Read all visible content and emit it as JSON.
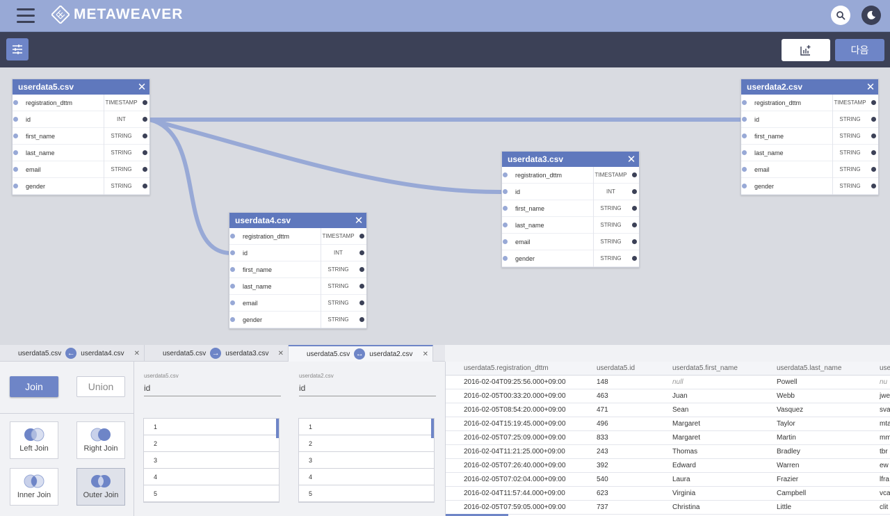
{
  "app": {
    "name": "METAWEAVER"
  },
  "toolbar": {
    "next_label": "다음"
  },
  "colors": {
    "accent": "#6e85c7",
    "header": "#98a9d6",
    "dark": "#3c4157",
    "link": "#98a9d6"
  },
  "tables": [
    {
      "name": "userdata5.csv",
      "columns": [
        {
          "name": "registration_dttm",
          "type": "TIMESTAMP"
        },
        {
          "name": "id",
          "type": "INT"
        },
        {
          "name": "first_name",
          "type": "STRING"
        },
        {
          "name": "last_name",
          "type": "STRING"
        },
        {
          "name": "email",
          "type": "STRING"
        },
        {
          "name": "gender",
          "type": "STRING"
        }
      ]
    },
    {
      "name": "userdata2.csv",
      "columns": [
        {
          "name": "registration_dttm",
          "type": "TIMESTAMP"
        },
        {
          "name": "id",
          "type": "STRING"
        },
        {
          "name": "first_name",
          "type": "STRING"
        },
        {
          "name": "last_name",
          "type": "STRING"
        },
        {
          "name": "email",
          "type": "STRING"
        },
        {
          "name": "gender",
          "type": "STRING"
        }
      ]
    },
    {
      "name": "userdata3.csv",
      "columns": [
        {
          "name": "registration_dttm",
          "type": "TIMESTAMP"
        },
        {
          "name": "id",
          "type": "INT"
        },
        {
          "name": "first_name",
          "type": "STRING"
        },
        {
          "name": "last_name",
          "type": "STRING"
        },
        {
          "name": "email",
          "type": "STRING"
        },
        {
          "name": "gender",
          "type": "STRING"
        }
      ]
    },
    {
      "name": "userdata4.csv",
      "columns": [
        {
          "name": "registration_dttm",
          "type": "TIMESTAMP"
        },
        {
          "name": "id",
          "type": "INT"
        },
        {
          "name": "first_name",
          "type": "STRING"
        },
        {
          "name": "last_name",
          "type": "STRING"
        },
        {
          "name": "email",
          "type": "STRING"
        },
        {
          "name": "gender",
          "type": "STRING"
        }
      ]
    }
  ],
  "tabs": [
    {
      "left": "userdata5.csv",
      "right": "userdata4.csv",
      "arrow": "←"
    },
    {
      "left": "userdata5.csv",
      "right": "userdata3.csv",
      "arrow": "→"
    },
    {
      "left": "userdata5.csv",
      "right": "userdata2.csv",
      "arrow": "↔"
    }
  ],
  "join": {
    "join_label": "Join",
    "union_label": "Union",
    "types": [
      "Left Join",
      "Right Join",
      "Inner Join",
      "Outer Join"
    ],
    "left_table": "userdata5.csv",
    "left_key": "id",
    "right_table": "userdata2.csv",
    "right_key": "id",
    "values": [
      "1",
      "2",
      "3",
      "4",
      "5"
    ]
  },
  "grid": {
    "headers": [
      "userdata5.registration_dttm",
      "userdata5.id",
      "userdata5.first_name",
      "userdata5.last_name",
      "use"
    ],
    "rows": [
      [
        "2016-02-04T09:25:56.000+09:00",
        "148",
        "null",
        "Powell",
        "nu"
      ],
      [
        "2016-02-05T00:33:20.000+09:00",
        "463",
        "Juan",
        "Webb",
        "jwe"
      ],
      [
        "2016-02-05T08:54:20.000+09:00",
        "471",
        "Sean",
        "Vasquez",
        "sva"
      ],
      [
        "2016-02-04T15:19:45.000+09:00",
        "496",
        "Margaret",
        "Taylor",
        "mta"
      ],
      [
        "2016-02-05T07:25:09.000+09:00",
        "833",
        "Margaret",
        "Martin",
        "mm"
      ],
      [
        "2016-02-04T11:21:25.000+09:00",
        "243",
        "Thomas",
        "Bradley",
        "tbr"
      ],
      [
        "2016-02-05T07:26:40.000+09:00",
        "392",
        "Edward",
        "Warren",
        "ew"
      ],
      [
        "2016-02-05T07:02:04.000+09:00",
        "540",
        "Laura",
        "Frazier",
        "lfra"
      ],
      [
        "2016-02-04T11:57:44.000+09:00",
        "623",
        "Virginia",
        "Campbell",
        "vca"
      ],
      [
        "2016-02-05T07:59:05.000+09:00",
        "737",
        "Christina",
        "Little",
        "clit"
      ]
    ]
  }
}
